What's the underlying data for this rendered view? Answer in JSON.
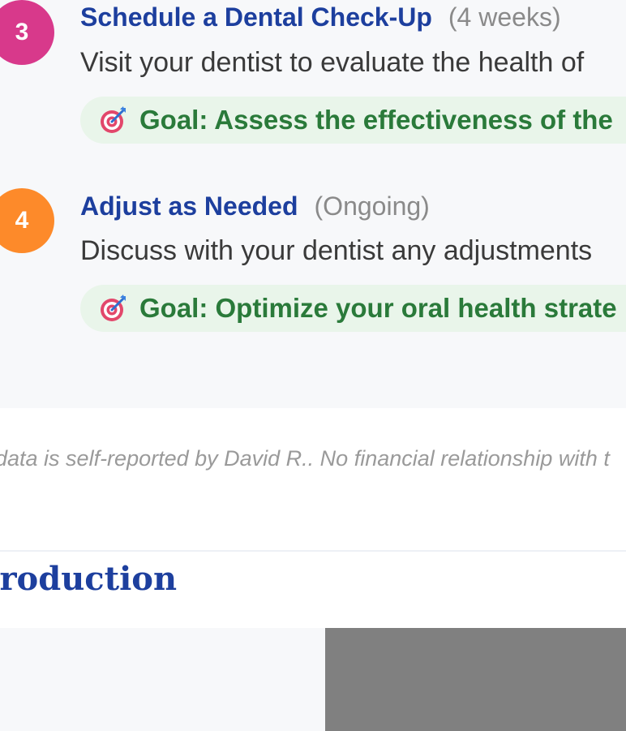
{
  "steps": [
    {
      "number": "3",
      "title": "Schedule a Dental Check-Up",
      "duration": "(4 weeks)",
      "description": "Visit your dentist to evaluate the health of",
      "goal": "Goal: Assess the effectiveness of the",
      "badge_color": "#d8398b"
    },
    {
      "number": "4",
      "title": "Adjust as Needed",
      "duration": "(Ongoing)",
      "description": "Discuss with your dentist any adjustments",
      "goal": "Goal: Optimize your oral health strate",
      "badge_color": "#fd8a2a"
    }
  ],
  "goal_icon": "target-dart-icon",
  "disclaimer": "data is self-reported by David R.. No financial relationship with t",
  "section": {
    "heading": "troduction"
  },
  "colors": {
    "title_blue": "#1d3f9e",
    "goal_green": "#2a7a3a",
    "goal_bg": "#e9f5ea",
    "panel_bg": "#f7f8fa",
    "placeholder_gray": "#808080"
  }
}
